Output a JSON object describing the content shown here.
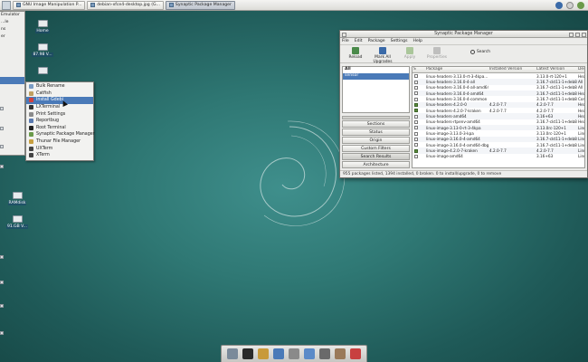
{
  "taskbar": {
    "tasks": [
      {
        "label": "GNU Image Manipulation P...",
        "active": false
      },
      {
        "label": "debian-xfce4-desktop.jpg (G...",
        "active": false
      },
      {
        "label": "Synaptic Package Manager",
        "active": true
      }
    ],
    "tray_icons": [
      "network-icon",
      "audio-icon",
      "power-icon"
    ]
  },
  "desktop": {
    "icons": [
      {
        "label": "Home"
      },
      {
        "label": "87.98 V..."
      },
      {
        "label": "RAMdisk"
      },
      {
        "label": "91.GB V..."
      }
    ]
  },
  "start_menu": {
    "items": [
      "Emulator",
      "...le",
      "ns",
      "er",
      "",
      "",
      "",
      "",
      "",
      "",
      "",
      ""
    ]
  },
  "submenu": {
    "items": [
      {
        "label": "Bulk Rename",
        "icon_color": "#7a9cc4",
        "selected": false
      },
      {
        "label": "Catfish",
        "icon_color": "#c0a060",
        "selected": false
      },
      {
        "label": "Install Gdebi",
        "icon_color": "#d04040",
        "selected": true
      },
      {
        "label": "LXTerminal",
        "icon_color": "#333333",
        "selected": false
      },
      {
        "label": "Print Settings",
        "icon_color": "#8a8a8a",
        "selected": false
      },
      {
        "label": "Reportbug",
        "icon_color": "#5a7ab0",
        "selected": false
      },
      {
        "label": "Root Terminal",
        "icon_color": "#222222",
        "selected": false
      },
      {
        "label": "Synaptic Package Manager",
        "icon_color": "#6a9a4a",
        "selected": false
      },
      {
        "label": "Thunar File Manager",
        "icon_color": "#c8a040",
        "selected": false
      },
      {
        "label": "UXTerm",
        "icon_color": "#444444",
        "selected": false
      },
      {
        "label": "XTerm",
        "icon_color": "#444444",
        "selected": false
      }
    ]
  },
  "synaptic": {
    "title": "Synaptic Package Manager",
    "menus": [
      "File",
      "Edit",
      "Package",
      "Settings",
      "Help"
    ],
    "toolbar": [
      {
        "label": "Reload",
        "color": "#4a8a4a",
        "disabled": false
      },
      {
        "label": "Mark All Upgrades",
        "color": "#3a6aa8",
        "disabled": false
      },
      {
        "label": "Apply",
        "color": "#5a9a3a",
        "disabled": true
      },
      {
        "label": "Properties",
        "color": "#8a8a8a",
        "disabled": true
      }
    ],
    "search_label": "Search",
    "filter": {
      "header": "All",
      "items": [
        {
          "label": "sensor",
          "selected": true
        }
      ]
    },
    "filter_buttons": [
      {
        "label": "Sections",
        "on": false
      },
      {
        "label": "Status",
        "on": false
      },
      {
        "label": "Origin",
        "on": false
      },
      {
        "label": "Custom Filters",
        "on": false
      },
      {
        "label": "Search Results",
        "on": true
      },
      {
        "label": "Architecture",
        "on": false
      }
    ],
    "columns": {
      "s": "S",
      "package": "Package",
      "installed": "Installed Version",
      "latest": "Latest Version",
      "desc": "Desc"
    },
    "rows": [
      {
        "installed_flag": false,
        "package": "linux-headers-3.13.0-rt-3-4kpa...",
        "installed": "",
        "latest": "3.13.0-rt-120+1",
        "desc": "Hea"
      },
      {
        "installed_flag": false,
        "package": "linux-headers-3.16.0-4-all",
        "installed": "",
        "latest": "3.16.7-ckt11-1+deb8u",
        "desc": "All"
      },
      {
        "installed_flag": false,
        "package": "linux-headers-3.16.0-4-all-amd64",
        "installed": "",
        "latest": "3.16.7-ckt11-1+deb8u",
        "desc": "All"
      },
      {
        "installed_flag": false,
        "package": "linux-headers-3.16.0-4-amd64",
        "installed": "",
        "latest": "3.16.7-ckt11-1+deb8u",
        "desc": "Hea"
      },
      {
        "installed_flag": false,
        "package": "linux-headers-3.16.0-4-common",
        "installed": "",
        "latest": "3.16.7-ckt11-1+deb8u",
        "desc": "Com"
      },
      {
        "installed_flag": true,
        "package": "linux-headers-4.2.0-0",
        "installed": "4.2.0-7.7",
        "latest": "4.2.0-7.7",
        "desc": "Hea"
      },
      {
        "installed_flag": true,
        "package": "linux-headers-4.2.0-7-kraken",
        "installed": "4.2.0-7.7",
        "latest": "4.2.0-7.7",
        "desc": "Hea"
      },
      {
        "installed_flag": false,
        "package": "linux-headers-amd64",
        "installed": "",
        "latest": "3.16+63",
        "desc": "Hea"
      },
      {
        "installed_flag": false,
        "package": "linux-headers-rtpenv-amd64",
        "installed": "",
        "latest": "3.16.7-ckt11-1+deb8u",
        "desc": "Hea"
      },
      {
        "installed_flag": false,
        "package": "linux-image-3.13-0-rt-3-4kpa",
        "installed": "",
        "latest": "3.13.0rc-120+1",
        "desc": "Linu"
      },
      {
        "installed_flag": false,
        "package": "linux-image-3.13.0-3-kpa",
        "installed": "",
        "latest": "3.13.0rc-120+1",
        "desc": "Linu"
      },
      {
        "installed_flag": false,
        "package": "linux-image-3.16.0-4-amd64",
        "installed": "",
        "latest": "3.16.7-ckt11-1+deb8u",
        "desc": "Linu"
      },
      {
        "installed_flag": false,
        "package": "linux-image-3.16.0-4-amd64-dbg",
        "installed": "",
        "latest": "3.16.7-ckt11-1+deb8u",
        "desc": "Linu"
      },
      {
        "installed_flag": true,
        "package": "linux-image-4.2.0-7-kraken",
        "installed": "4.2.0-7.7",
        "latest": "4.2.0-7.7",
        "desc": "Linu"
      },
      {
        "installed_flag": false,
        "package": "linux-image-amd64",
        "installed": "",
        "latest": "3.16+63",
        "desc": "Linu"
      }
    ],
    "status": "955 packages listed, 1394 installed, 0 broken. 0 to install/upgrade, 0 to remove"
  },
  "dock": {
    "icons": [
      {
        "name": "show-desktop-icon",
        "color": "#7a8a9a"
      },
      {
        "name": "terminal-icon",
        "color": "#2a2a2a"
      },
      {
        "name": "file-manager-icon",
        "color": "#c89a3a"
      },
      {
        "name": "web-browser-icon",
        "color": "#4a7ab8"
      },
      {
        "name": "application-finder-icon",
        "color": "#8a8a8a"
      },
      {
        "name": "folder-icon",
        "color": "#5a8ac8"
      },
      {
        "name": "image-viewer-icon",
        "color": "#6a6a6a"
      },
      {
        "name": "gimp-icon",
        "color": "#9a7a5a"
      },
      {
        "name": "system-tool-icon",
        "color": "#c84040"
      }
    ]
  },
  "colors": {
    "selection": "#4a7ab8",
    "desktop": "#2f7874"
  }
}
